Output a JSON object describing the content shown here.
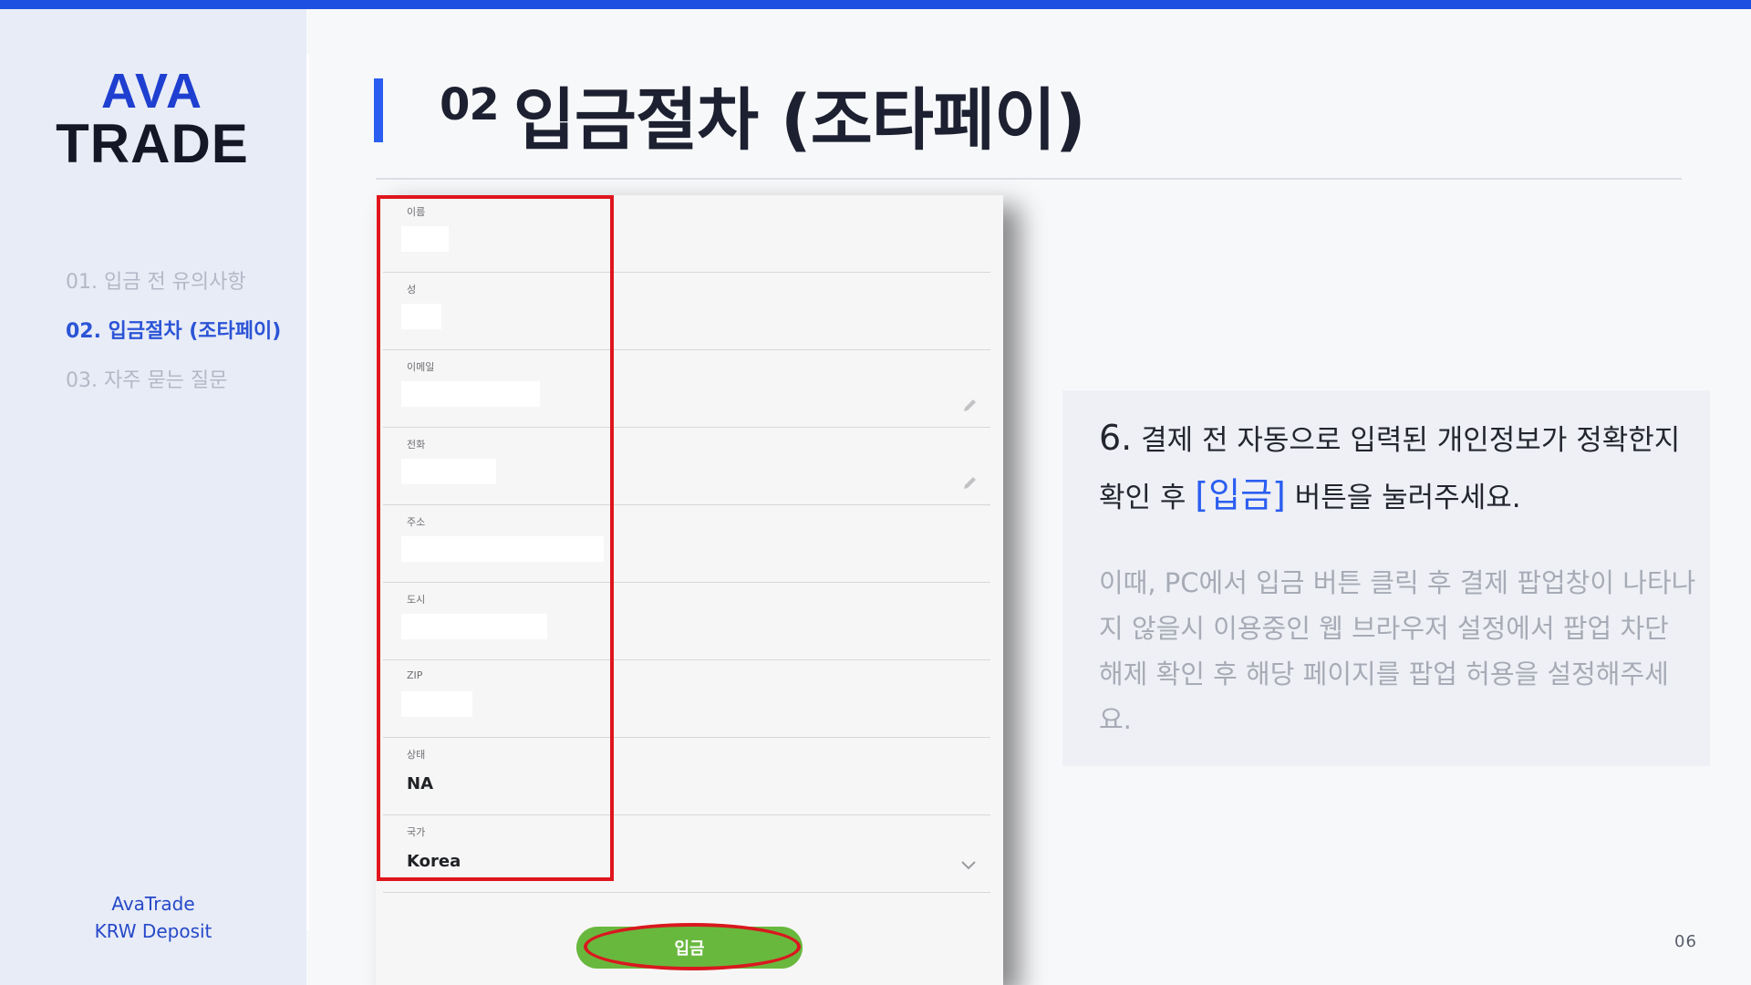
{
  "colors": {
    "accent": "#2b5ef0",
    "topbar": "#1d4fe0",
    "highlight_red": "#e0151d",
    "button_green": "#69b83e"
  },
  "brand": {
    "logo_line1": "AVA",
    "logo_line2": "TRADE",
    "footer_line1": "AvaTrade",
    "footer_line2": "KRW Deposit"
  },
  "nav": {
    "items": [
      {
        "label": "01. 입금 전 유의사항",
        "active": false
      },
      {
        "label": "02. 입금절차 (조타페이)",
        "active": true
      },
      {
        "label": "03. 자주 묻는 질문",
        "active": false
      }
    ]
  },
  "header": {
    "number": "02",
    "title": "입금절차 (조타페이)"
  },
  "form": {
    "fields": [
      {
        "label": "이름",
        "value": ""
      },
      {
        "label": "성",
        "value": ""
      },
      {
        "label": "이메일",
        "value": "",
        "icon": "pencil-icon"
      },
      {
        "label": "전화",
        "value": "",
        "icon": "pencil-icon"
      },
      {
        "label": "주소",
        "value": ""
      },
      {
        "label": "도시",
        "value": ""
      },
      {
        "label": "ZIP",
        "value": ""
      },
      {
        "label": "상태",
        "value": "NA"
      },
      {
        "label": "국가",
        "value": "Korea",
        "icon": "chevron-down-icon"
      }
    ],
    "submit_label": "입금"
  },
  "instruction": {
    "step_number": "6.",
    "step_text_before": "결제 전 자동으로 입력된 개인정보가 정확한지 확인 후",
    "step_highlight": "[입금]",
    "step_text_after": "버튼을 눌러주세요.",
    "note": "이때, PC에서 입금 버튼 클릭 후 결제 팝업창이 나타나지 않을시 이용중인 웹 브라우저 설정에서 팝업 차단 해제 확인 후 해당 페이지를 팝업 허용을 설정해주세요."
  },
  "page_number": "06"
}
